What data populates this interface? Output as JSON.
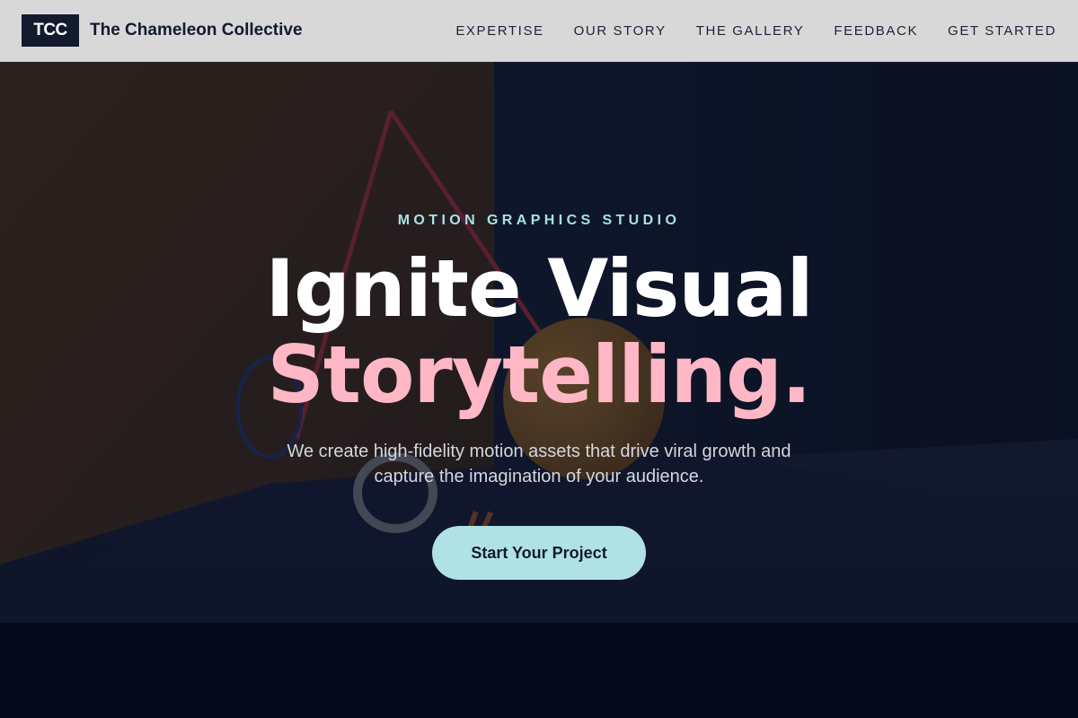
{
  "header": {
    "logo_text_main": "TC",
    "logo_text_accent": "C",
    "brand_name": "The Chameleon Collective",
    "nav": [
      {
        "label": "EXPERTISE"
      },
      {
        "label": "OUR STORY"
      },
      {
        "label": "THE GALLERY"
      },
      {
        "label": "FEEDBACK"
      },
      {
        "label": "GET STARTED"
      }
    ]
  },
  "hero": {
    "eyebrow": "MOTION GRAPHICS STUDIO",
    "headline_line1": "Ignite Visual",
    "headline_line2": "Storytelling.",
    "subtitle": "We create high-fidelity motion assets that drive viral growth and capture the imagination of your audience.",
    "cta_label": "Start Your Project"
  },
  "colors": {
    "header_bg": "#d9d8d9",
    "brand_dark": "#121a2e",
    "eyebrow": "#a8e1e5",
    "headline_accent": "#ffb7c5",
    "cta_bg": "#b0e2e5",
    "page_bg": "#060a1a"
  }
}
